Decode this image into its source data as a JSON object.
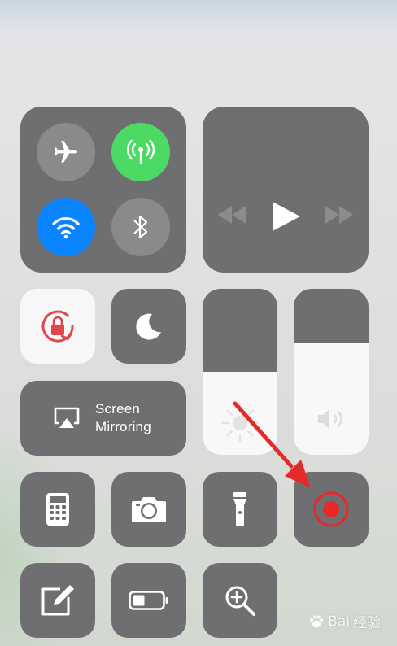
{
  "connectivity": {
    "airplane_mode": {
      "icon": "airplane-icon",
      "active": false
    },
    "cellular_data": {
      "icon": "antenna-icon",
      "active": true,
      "color": "#4cd964"
    },
    "wifi": {
      "icon": "wifi-icon",
      "active": true,
      "color": "#0a84ff"
    },
    "bluetooth": {
      "icon": "bluetooth-icon",
      "active": false
    }
  },
  "media": {
    "icons": [
      "rewind-icon",
      "play-icon",
      "fast-forward-icon"
    ]
  },
  "toggles": {
    "orientation_lock": {
      "icon": "rotation-lock-icon",
      "active": true,
      "color": "#e0474c"
    },
    "do_not_disturb": {
      "icon": "moon-icon",
      "active": false
    }
  },
  "screen_mirroring": {
    "line1": "Screen",
    "line2": "Mirroring",
    "icon": "airplay-icon"
  },
  "brightness": {
    "icon": "sun-icon",
    "level": 0.5
  },
  "volume": {
    "icon": "speaker-icon",
    "level": 0.67
  },
  "shortcuts": [
    {
      "name": "calculator",
      "icon": "calculator-icon"
    },
    {
      "name": "camera",
      "icon": "camera-icon"
    },
    {
      "name": "flashlight",
      "icon": "flashlight-icon"
    },
    {
      "name": "screen-recording",
      "icon": "record-icon",
      "color": "#e8272b"
    },
    {
      "name": "notes",
      "icon": "notes-icon"
    },
    {
      "name": "low-power-mode",
      "icon": "battery-icon"
    },
    {
      "name": "magnifier",
      "icon": "magnifier-icon"
    }
  ],
  "annotation": {
    "color": "#e52a2a"
  },
  "watermark": {
    "brand": "Bai",
    "suffix": "经验",
    "icon": "paw-icon"
  },
  "colors": {
    "tile": "#6f6f71",
    "tile_light": "#f7f7f7",
    "circle_inactive": "#8a8a8c"
  }
}
